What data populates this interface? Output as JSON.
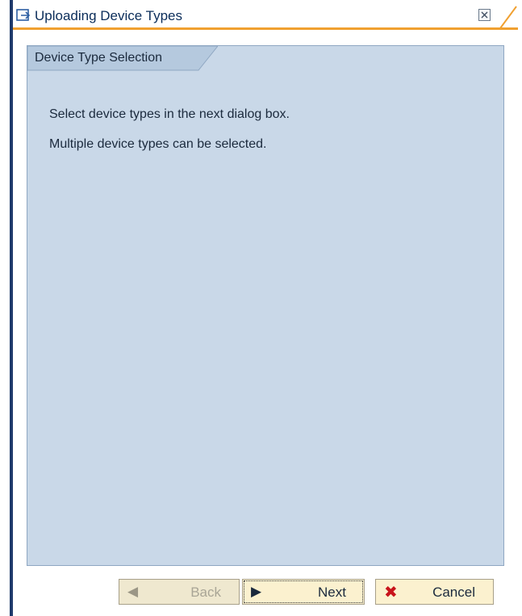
{
  "window": {
    "title": "Uploading Device Types"
  },
  "panel": {
    "tab_label": "Device Type Selection",
    "messages": [
      "Select device types in the next dialog box.",
      "Multiple device types can be selected."
    ]
  },
  "buttons": {
    "back": {
      "label": "Back",
      "icon": "triangle-left-icon",
      "enabled": false
    },
    "next": {
      "label": "Next",
      "icon": "triangle-right-icon",
      "enabled": true
    },
    "cancel": {
      "label": "Cancel",
      "icon": "red-x-icon",
      "enabled": true
    }
  },
  "colors": {
    "panel_bg": "#c9d8e8",
    "accent_orange": "#f0a030",
    "button_bg": "#fbf1cf",
    "cancel_icon": "#c8141b"
  }
}
